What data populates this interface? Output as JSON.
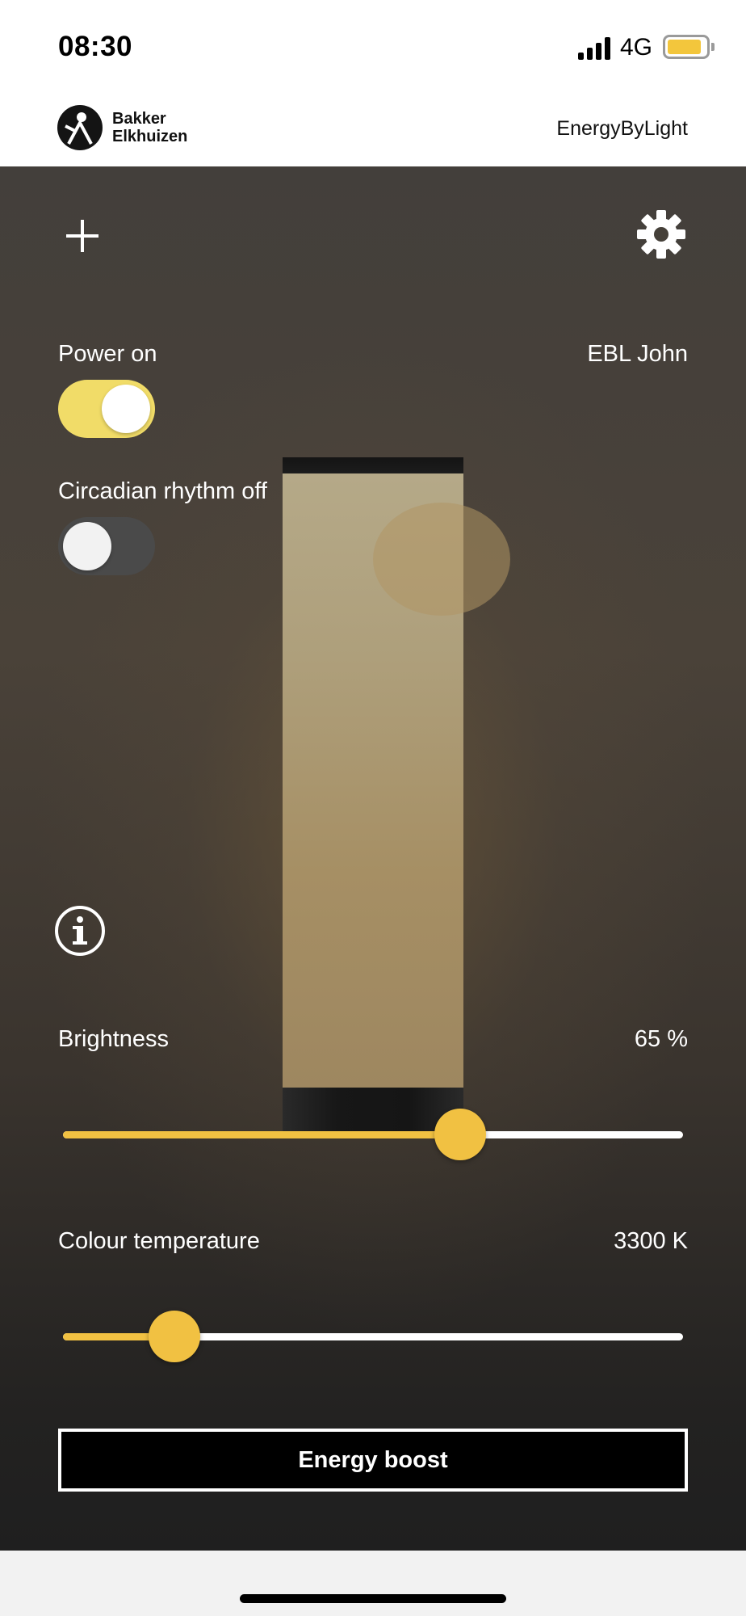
{
  "status_bar": {
    "time": "08:30",
    "network": "4G",
    "battery_level": 0.9,
    "battery_color": "#f3c63c"
  },
  "header": {
    "brand_line1": "Bakker",
    "brand_line2": "Elkhuizen",
    "product": "EnergyByLight",
    "logo_icon": "bakker-elkhuizen-logo"
  },
  "controls": {
    "add_icon": "plus-icon",
    "settings_icon": "gear-icon",
    "info_icon": "info-icon"
  },
  "power": {
    "label": "Power on",
    "on": true,
    "color": "#f1dc68"
  },
  "device": {
    "name": "EBL John"
  },
  "circadian": {
    "label": "Circadian rhythm off",
    "on": false
  },
  "brightness": {
    "label": "Brightness",
    "value_text": "65 %",
    "fraction": 0.64
  },
  "colour_temperature": {
    "label": "Colour temperature",
    "value_text": "3300 K",
    "fraction": 0.18
  },
  "accent_color": "#f1c142",
  "energy_boost": {
    "label": "Energy boost"
  }
}
